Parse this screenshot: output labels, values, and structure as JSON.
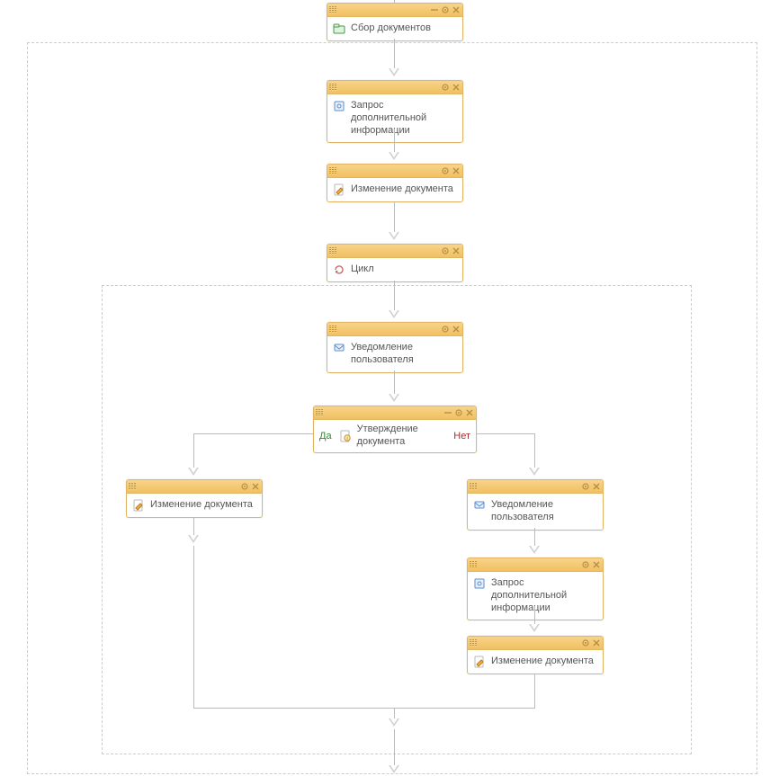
{
  "nodes": {
    "collect": {
      "label": "Сбор документов"
    },
    "request1": {
      "label": "Запрос дополнительной информации"
    },
    "change1": {
      "label": "Изменение документа"
    },
    "cycle": {
      "label": "Цикл"
    },
    "notify1": {
      "label": "Уведомление пользователя"
    },
    "approve": {
      "label": "Утверждение документа",
      "yes": "Да",
      "no": "Нет"
    },
    "change2": {
      "label": "Изменение документа"
    },
    "notify2": {
      "label": "Уведомление пользователя"
    },
    "request2": {
      "label": "Запрос дополнительной информации"
    },
    "change3": {
      "label": "Изменение документа"
    }
  },
  "colors": {
    "header": "#f2c061",
    "border": "#e1b566"
  }
}
